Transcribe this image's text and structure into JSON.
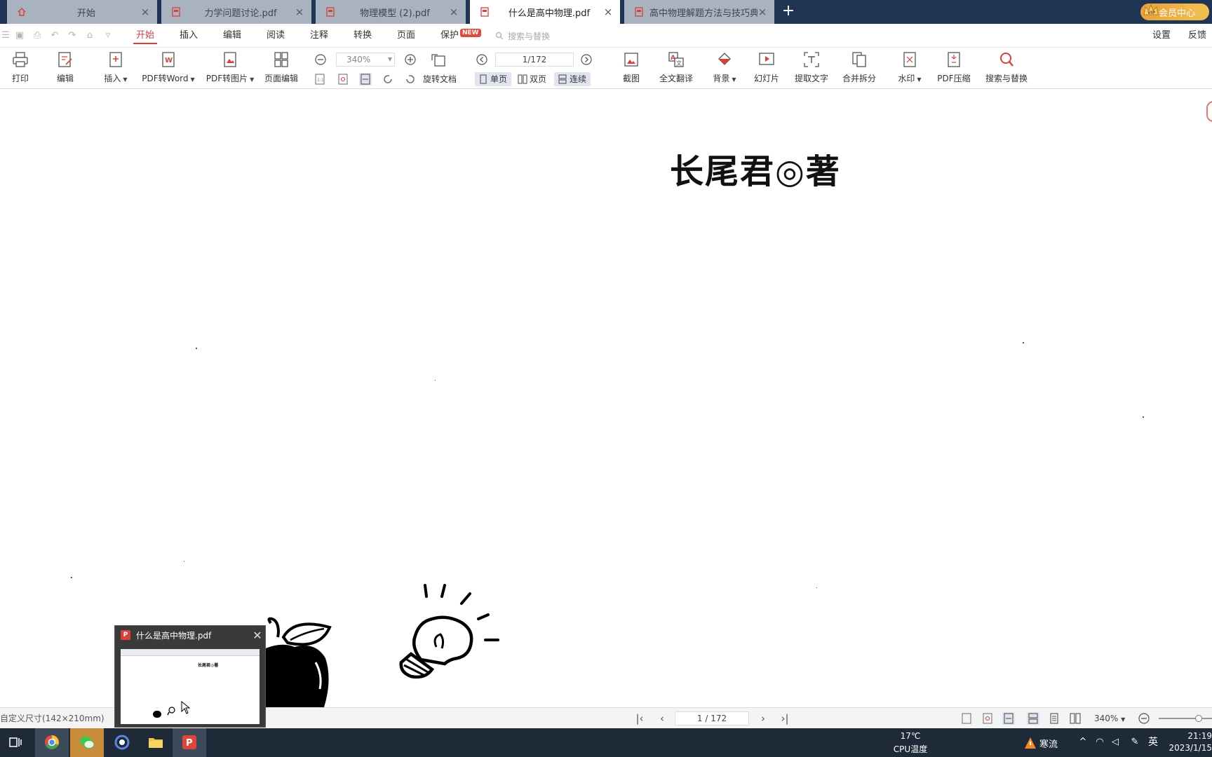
{
  "tabs": [
    {
      "label": "开始"
    },
    {
      "label": "力学问题讨论.pdf"
    },
    {
      "label": "物理模型 (2).pdf"
    },
    {
      "label": "什么是高中物理.pdf"
    },
    {
      "label": "高中物理解题方法与技巧典..."
    }
  ],
  "vip": {
    "label": "会员中心"
  },
  "menu": {
    "items": [
      "开始",
      "插入",
      "编辑",
      "阅读",
      "注释",
      "转换",
      "页面",
      "保护"
    ],
    "new_badge": "NEW",
    "search_placeholder": "搜索与替换",
    "settings": "设置",
    "feedback": "反馈"
  },
  "toolbar": {
    "print": "打印",
    "edit": "编辑",
    "insert": "插入",
    "pdf_to_word": "PDF转Word",
    "pdf_to_image": "PDF转图片",
    "page_edit": "页面编辑",
    "zoom": "340%",
    "page": "1/172",
    "rotate": "旋转文档",
    "single": "单页",
    "double": "双页",
    "continuous": "连续",
    "screenshot": "截图",
    "translate": "全文翻译",
    "background": "背景",
    "slideshow": "幻灯片",
    "extract_text": "提取文字",
    "merge_split": "合并拆分",
    "watermark": "水印",
    "compress": "PDF压缩",
    "search_replace": "搜索与替换"
  },
  "document": {
    "title": "长尾君◎著"
  },
  "statusbar": {
    "page_size": "自定义尺寸(142×210mm)",
    "page": "1 / 172",
    "zoom": "340%"
  },
  "preview": {
    "title": "什么是高中物理.pdf"
  },
  "taskbar": {
    "weather_temp": "17℃",
    "weather_label": "CPU温度",
    "alert": "寒流",
    "ime": "英",
    "time": "21:19",
    "date": "2023/1/15"
  },
  "colors": {
    "accent": "#d2423b",
    "tabbar_bg": "#1f3553",
    "taskbar_bg": "#1e2a38",
    "vip_gold": "#e8a23a"
  }
}
